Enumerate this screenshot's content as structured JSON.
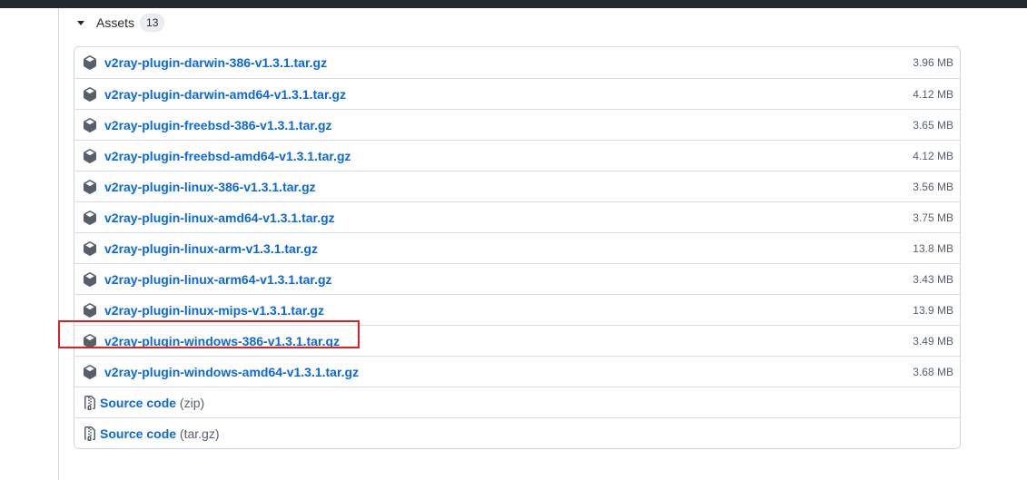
{
  "assets": {
    "title": "Assets",
    "count": "13",
    "files": [
      {
        "name": "v2ray-plugin-darwin-386-v1.3.1.tar.gz",
        "size": "3.96 MB"
      },
      {
        "name": "v2ray-plugin-darwin-amd64-v1.3.1.tar.gz",
        "size": "4.12 MB"
      },
      {
        "name": "v2ray-plugin-freebsd-386-v1.3.1.tar.gz",
        "size": "3.65 MB"
      },
      {
        "name": "v2ray-plugin-freebsd-amd64-v1.3.1.tar.gz",
        "size": "4.12 MB"
      },
      {
        "name": "v2ray-plugin-linux-386-v1.3.1.tar.gz",
        "size": "3.56 MB"
      },
      {
        "name": "v2ray-plugin-linux-amd64-v1.3.1.tar.gz",
        "size": "3.75 MB"
      },
      {
        "name": "v2ray-plugin-linux-arm-v1.3.1.tar.gz",
        "size": "13.8 MB"
      },
      {
        "name": "v2ray-plugin-linux-arm64-v1.3.1.tar.gz",
        "size": "3.43 MB"
      },
      {
        "name": "v2ray-plugin-linux-mips-v1.3.1.tar.gz",
        "size": "13.9 MB"
      },
      {
        "name": "v2ray-plugin-windows-386-v1.3.1.tar.gz",
        "size": "3.49 MB"
      },
      {
        "name": "v2ray-plugin-windows-amd64-v1.3.1.tar.gz",
        "size": "3.68 MB"
      }
    ],
    "source": [
      {
        "label": "Source code",
        "format": "(zip)"
      },
      {
        "label": "Source code",
        "format": "(tar.gz)"
      }
    ]
  },
  "colors": {
    "link": "#0969da",
    "muted": "#57606a",
    "highlight": "#e02020"
  },
  "icons": {
    "package": "package-icon",
    "source": "file-zip-icon",
    "caret": "triangle-down-icon"
  }
}
